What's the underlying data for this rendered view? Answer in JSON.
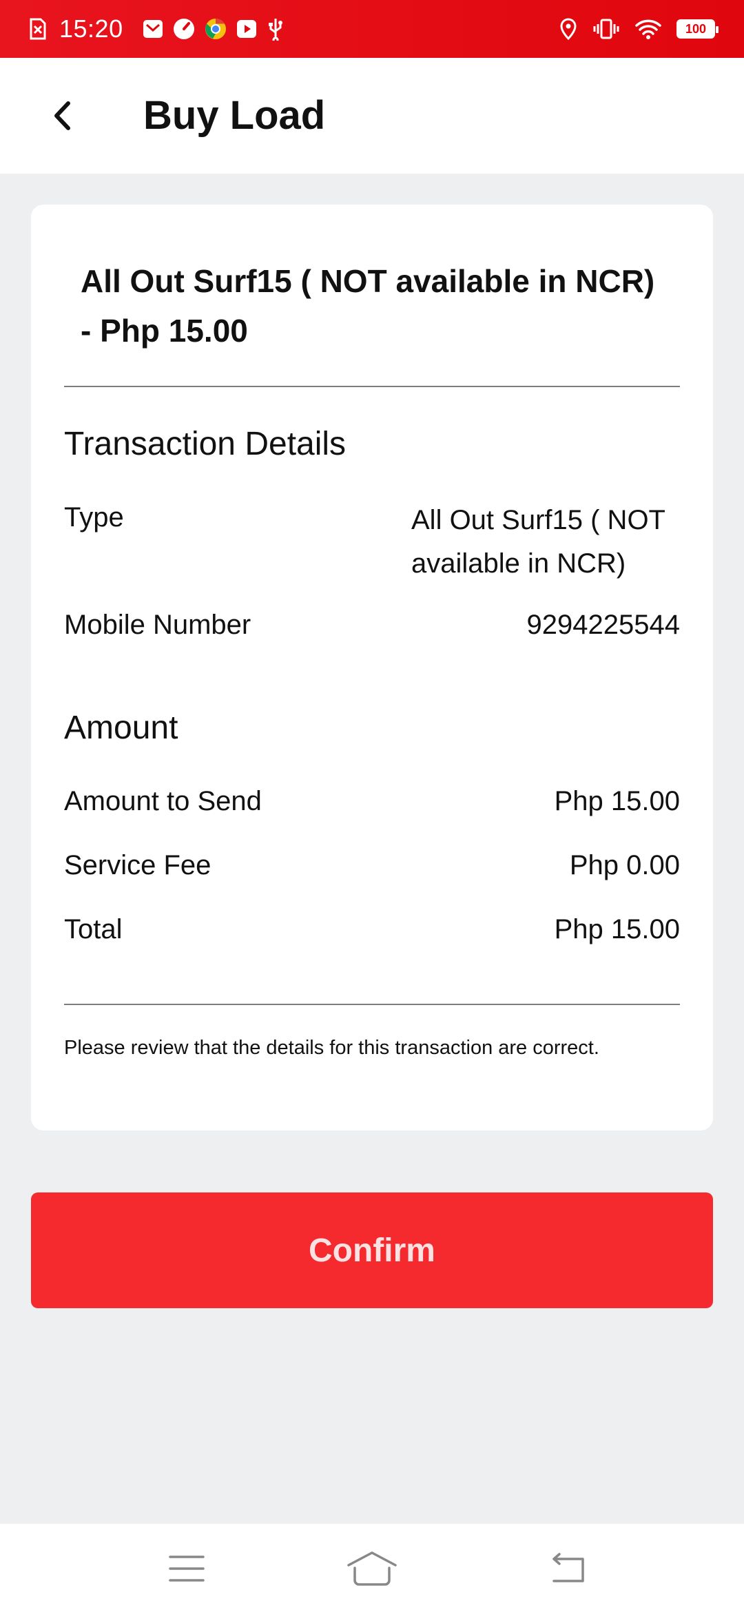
{
  "status_bar": {
    "time": "15:20",
    "battery": "100",
    "left_icons": [
      "sim-x-icon",
      "mail-icon",
      "speed-icon",
      "chrome-icon",
      "youtube-icon",
      "usb-icon"
    ],
    "right_icons": [
      "location-icon",
      "vibrate-icon",
      "wifi-icon",
      "battery-icon"
    ]
  },
  "header": {
    "title": "Buy Load",
    "back_icon": "chevron-left-icon"
  },
  "card": {
    "product_title": "All Out Surf15 ( NOT available in NCR) - Php 15.00",
    "transaction_section": "Transaction Details",
    "type_label": "Type",
    "type_value": "All Out Surf15 ( NOT available in NCR)",
    "mobile_label": "Mobile Number",
    "mobile_value": "9294225544",
    "amount_section": "Amount",
    "amount_to_send_label": "Amount to Send",
    "amount_to_send_value": "Php 15.00",
    "service_fee_label": "Service Fee",
    "service_fee_value": "Php 0.00",
    "total_label": "Total",
    "total_value": "Php 15.00",
    "note": "Please review that the details for this transaction are correct."
  },
  "confirm_label": "Confirm",
  "nav_bar": {
    "icons": [
      "menu-icon",
      "home-icon",
      "back-icon"
    ]
  },
  "colors": {
    "status_bar": "#e0060d",
    "confirm_button": "#f42a2e",
    "background": "#eeeff1"
  }
}
